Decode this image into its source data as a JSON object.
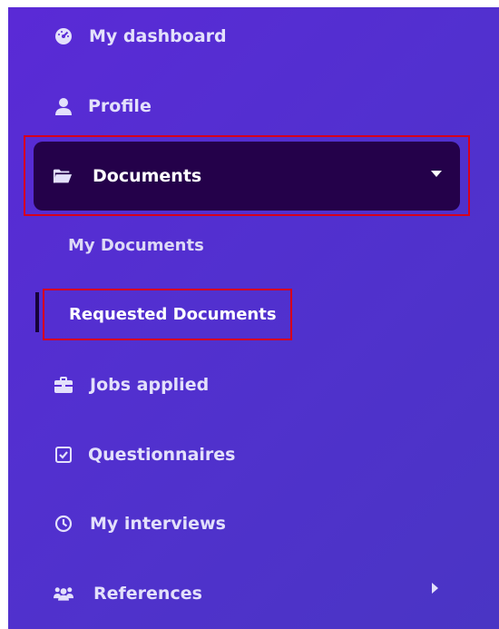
{
  "sidebar": {
    "items": {
      "dashboard": {
        "label": "My dashboard",
        "icon": "tachometer-icon"
      },
      "profile": {
        "label": "Profile",
        "icon": "user-icon"
      },
      "documents": {
        "label": "Documents",
        "icon": "folder-open-icon",
        "expanded": true
      },
      "my_documents": {
        "label": "My Documents"
      },
      "requested_documents": {
        "label": "Requested Documents",
        "active": true
      },
      "jobs_applied": {
        "label": "Jobs applied",
        "icon": "briefcase-icon"
      },
      "questionnaires": {
        "label": "Questionnaires",
        "icon": "checkbox-icon"
      },
      "my_interviews": {
        "label": "My interviews",
        "icon": "clock-icon"
      },
      "references": {
        "label": "References",
        "icon": "users-icon",
        "expanded": false
      }
    },
    "colors": {
      "background_start": "#5a2ad6",
      "background_end": "#4a35c4",
      "active_background": "#24014a",
      "highlight_border": "#d6001c",
      "text": "#e3e0fb"
    }
  }
}
